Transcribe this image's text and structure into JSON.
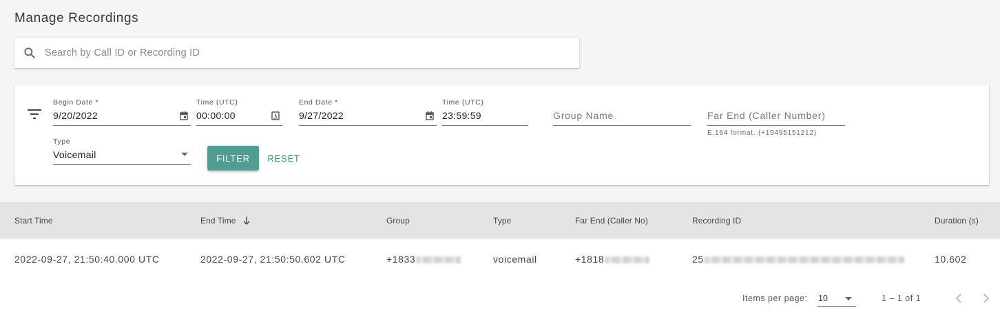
{
  "page": {
    "title": "Manage Recordings"
  },
  "search": {
    "placeholder": "Search by Call ID or Recording ID",
    "icon": "search-icon"
  },
  "filters": {
    "icon": "filter-list-icon",
    "begin_date": {
      "label": "Begin Date *",
      "value": "9/20/2022",
      "icon": "calendar-icon"
    },
    "begin_time": {
      "label": "Time (UTC)",
      "value": "00:00:00",
      "icon": "clock-icon"
    },
    "end_date": {
      "label": "End Date *",
      "value": "9/27/2022",
      "icon": "calendar-icon"
    },
    "end_time": {
      "label": "Time (UTC)",
      "value": "23:59:59"
    },
    "group_name": {
      "placeholder": "Group Name"
    },
    "far_end": {
      "placeholder": "Far End (Caller Number)",
      "hint": "E.164 format. (+19495151212)"
    },
    "type": {
      "label": "Type",
      "value": "Voicemail"
    },
    "filter_label": "FILTER",
    "reset_label": "RESET"
  },
  "table": {
    "columns": [
      "Start Time",
      "End Time",
      "Group",
      "Type",
      "Far End (Caller No)",
      "Recording ID",
      "Duration (s)"
    ],
    "sorted_column": "End Time",
    "sort_direction": "descending",
    "rows": [
      {
        "start_time": "2022-09-27, 21:50:40.000 UTC",
        "end_time": "2022-09-27, 21:50:50.602 UTC",
        "group": "+1833",
        "type": "voicemail",
        "far_end": "+1818",
        "recording_id": "25",
        "duration": "10.602"
      }
    ]
  },
  "pagination": {
    "items_per_page_label": "Items per page:",
    "items_per_page": "10",
    "range": "1 – 1 of 1"
  },
  "colors": {
    "accent": "#4e9e93",
    "accent_text": "#3d8f84",
    "header_bg": "#e4e4e4",
    "page_bg": "#f5f5f5"
  }
}
